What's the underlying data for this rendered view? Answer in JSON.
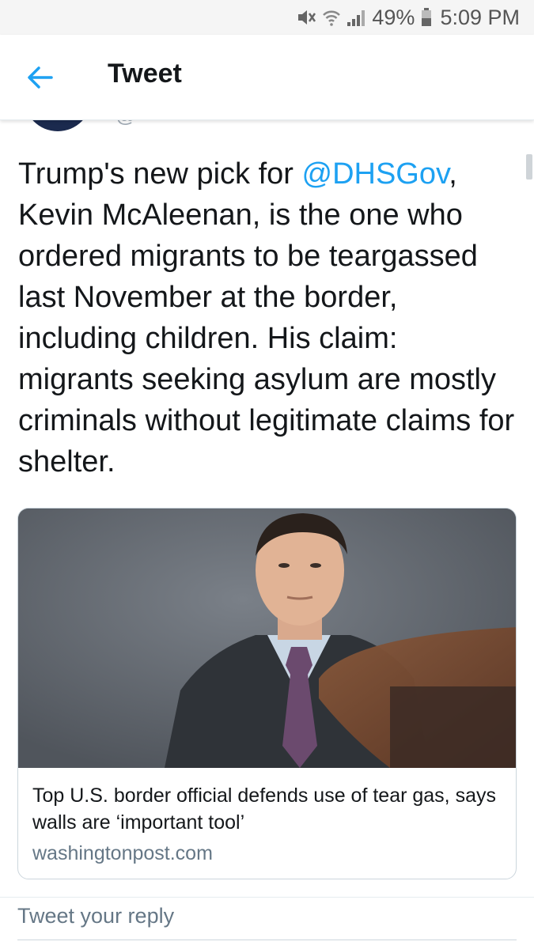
{
  "status_bar": {
    "battery": "49%",
    "time": "5:09 PM",
    "icons": [
      "mute-icon",
      "wifi-icon",
      "signal-icon",
      "battery-icon"
    ]
  },
  "header": {
    "back_icon": "back-arrow-icon",
    "title": "Tweet"
  },
  "tweet": {
    "author_handle_partial": "@",
    "text_before": "Trump's new pick for ",
    "mention": "@DHSGov",
    "text_after": ", Kevin McAleenan, is the one who ordered migrants to be teargassed last November at the border, including children. His claim: migrants seeking asylum are mostly criminals without legitimate claims for shelter."
  },
  "link_card": {
    "title": "Top U.S. border official defends use of tear gas, says walls are ‘important tool’",
    "domain": "washingtonpost.com"
  },
  "reply": {
    "placeholder": "Tweet your reply"
  },
  "colors": {
    "accent": "#1da1f2",
    "text": "#14171a",
    "secondary": "#657786",
    "border": "#ccd6dd"
  }
}
